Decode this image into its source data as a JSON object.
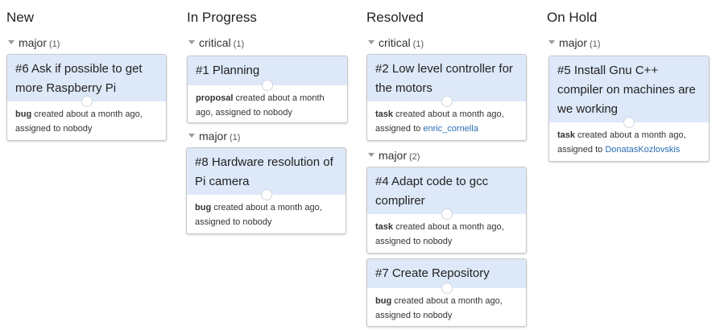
{
  "columns": [
    {
      "title": "New",
      "groups": [
        {
          "label": "major",
          "count": "(1)",
          "cards": [
            {
              "title": "#6 Ask if possible to get more Raspberry Pi",
              "type": "bug",
              "created": "created about a month ago,",
              "assigned_prefix": "assigned to",
              "assignee": "nobody"
            }
          ]
        }
      ]
    },
    {
      "title": "In Progress",
      "groups": [
        {
          "label": "critical",
          "count": "(1)",
          "cards": [
            {
              "title": "#1 Planning",
              "type": "proposal",
              "created": "created about a month ago,",
              "assigned_prefix": "assigned to",
              "assignee": "nobody"
            }
          ]
        },
        {
          "label": "major",
          "count": "(1)",
          "cards": [
            {
              "title": "#8 Hardware resolution of Pi camera",
              "type": "bug",
              "created": "created about a month ago,",
              "assigned_prefix": "assigned to",
              "assignee": "nobody"
            }
          ]
        }
      ]
    },
    {
      "title": "Resolved",
      "groups": [
        {
          "label": "critical",
          "count": "(1)",
          "cards": [
            {
              "title": "#2 Low level controller for the motors",
              "type": "task",
              "created": "created about a month ago,",
              "assigned_prefix": "assigned to",
              "assignee": "enric_cornella"
            }
          ]
        },
        {
          "label": "major",
          "count": "(2)",
          "cards": [
            {
              "title": "#4 Adapt code to gcc complirer",
              "type": "task",
              "created": "created about a month ago,",
              "assigned_prefix": "assigned to",
              "assignee": "nobody"
            },
            {
              "title": "#7 Create Repository",
              "type": "bug",
              "created": "created about a month ago,",
              "assigned_prefix": "assigned to",
              "assignee": "nobody"
            }
          ]
        }
      ]
    },
    {
      "title": "On Hold",
      "groups": [
        {
          "label": "major",
          "count": "(1)",
          "cards": [
            {
              "title": "#5 Install Gnu C++ compiler on machines are we working",
              "type": "task",
              "created": "created about a month ago,",
              "assigned_prefix": "assigned to",
              "assignee": "DonatasKozlovskis"
            }
          ]
        }
      ]
    }
  ]
}
